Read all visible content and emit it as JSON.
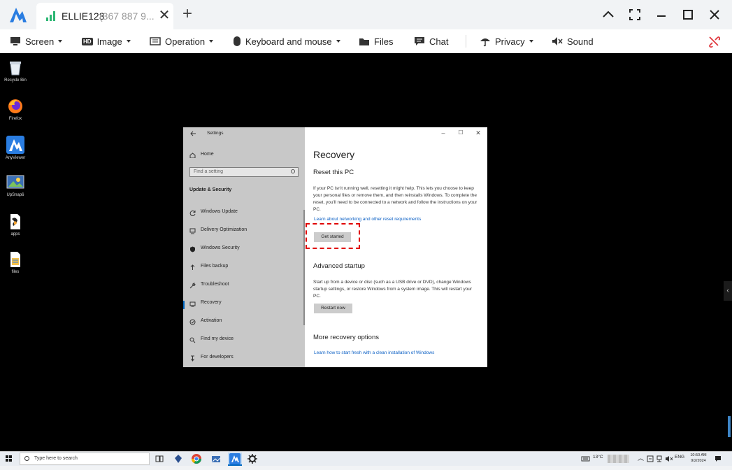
{
  "titlebar": {
    "session_name": "ELLIE123",
    "session_id": "(367 887 9...",
    "close_tab": "✕",
    "new_tab": "+",
    "window_buttons": {
      "collapse": "︿",
      "fullscreen": "⛶",
      "minimize": "—",
      "maximize": "☐",
      "close": "✕"
    }
  },
  "toolbar": {
    "screen": "Screen",
    "image": "Image",
    "image_badge": "HD",
    "operation": "Operation",
    "keyboard_mouse": "Keyboard and mouse",
    "files": "Files",
    "chat": "Chat",
    "privacy": "Privacy",
    "sound": "Sound",
    "disconnect_icon": "unlink-icon"
  },
  "desktop": {
    "icons": [
      {
        "label": "Recycle Bin",
        "icon": "recycle-bin-icon"
      },
      {
        "label": "Firefox",
        "icon": "firefox-icon"
      },
      {
        "label": "AnyViewer",
        "icon": "anyviewer-icon"
      },
      {
        "label": "UpSnap6",
        "icon": "upsnap-icon"
      },
      {
        "label": "apps",
        "icon": "apps-file-icon"
      },
      {
        "label": "files",
        "icon": "files-icon"
      }
    ]
  },
  "settings": {
    "window_title": "Settings",
    "home": "Home",
    "search_placeholder": "Find a setting",
    "section": "Update & Security",
    "nav": [
      "Windows Update",
      "Delivery Optimization",
      "Windows Security",
      "Files backup",
      "Troubleshoot",
      "Recovery",
      "Activation",
      "Find my device",
      "For developers"
    ],
    "selected_nav": "Recovery",
    "page_title": "Recovery",
    "reset_heading": "Reset this PC",
    "reset_text": "If your PC isn't running well, resetting it might help. This lets you choose to keep your personal files or remove them, and then reinstalls Windows. To complete the reset, you'll need to be connected to a network and follow the instructions on your PC.",
    "reset_link": "Learn about networking and other reset requirements",
    "get_started": "Get started",
    "advanced_heading": "Advanced startup",
    "advanced_text": "Start up from a device or disc (such as a USB drive or DVD), change Windows startup settings, or restore Windows from a system image. This will restart your PC.",
    "restart_now": "Restart now",
    "more_heading": "More recovery options",
    "more_link": "Learn how to start fresh with a clean installation of Windows",
    "accent_color": "#0067c0",
    "highlight_color": "#e00000"
  },
  "taskbar": {
    "search_placeholder": "Type here to search",
    "temperature": "13°C",
    "language": "ENG",
    "time": "10:50 AM",
    "date": "9/2/2024"
  }
}
